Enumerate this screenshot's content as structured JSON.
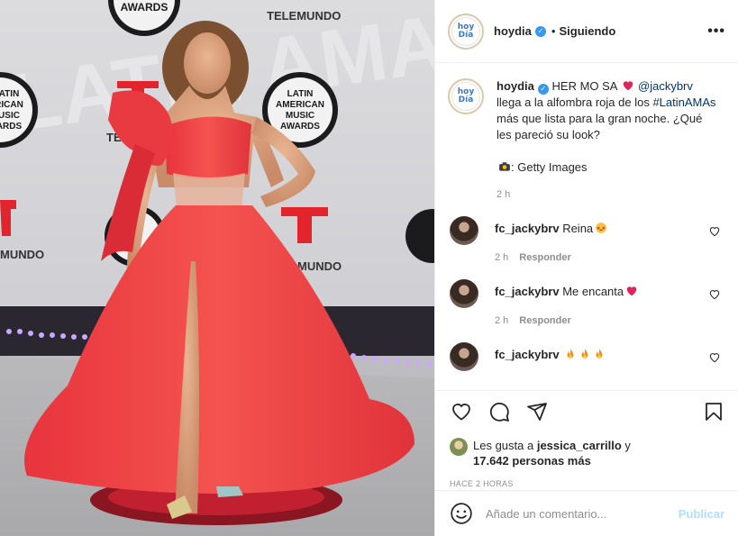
{
  "post": {
    "username": "hoydia",
    "separator": "•",
    "following_label": "Siguiendo",
    "more_icon": "more-dots-icon",
    "avatar_line1": "hoy",
    "avatar_line2": "Día"
  },
  "photo": {
    "backdrop_text_1": "AWARDS",
    "backdrop_text_2": "TELEMUNDO",
    "backdrop_text_3": "MUNDO",
    "backdrop_text_4": "MUNDO",
    "logo_line1": "LATIN",
    "logo_line2": "AMERICAN",
    "logo_line3": "MUSIC",
    "logo_line4": "AWARDS",
    "left_logo_line1": "ATIN",
    "left_logo_line2": "RICAN",
    "left_logo_line3": "USIC",
    "left_logo_line4": "ARDS",
    "left_te": "TE"
  },
  "caption": {
    "username": "hoydia",
    "text_part1": " HER MO SA ",
    "mention": "@jackybrv",
    "text_part2": " llega a la alfombra roja de los ",
    "hashtag": "#LatinAMAs",
    "text_part3": " más que lista para la gran noche. ¿Qué les pareció su look?",
    "credit": ": Getty Images",
    "time": "2 h"
  },
  "comments": [
    {
      "username": "fc_jackybrv",
      "text": "Reina",
      "time": "2 h",
      "reply": "Responder"
    },
    {
      "username": "fc_jackybrv",
      "text": "Me encanta",
      "time": "2 h",
      "reply": "Responder"
    },
    {
      "username": "fc_jackybrv",
      "text": ""
    }
  ],
  "likes": {
    "prefix": "Les gusta a ",
    "user": "jessica_carrillo",
    "and": " y",
    "count": "17.642 personas más"
  },
  "timestamp": "HACE 2 HORAS",
  "add_comment": {
    "placeholder": "Añade un comentario...",
    "publish_label": "Publicar"
  },
  "colors": {
    "accent_blue": "#3897f0",
    "link_blue": "#00376b",
    "publish_disabled": "#b2dffc",
    "dress_red": "#ef3f45"
  }
}
